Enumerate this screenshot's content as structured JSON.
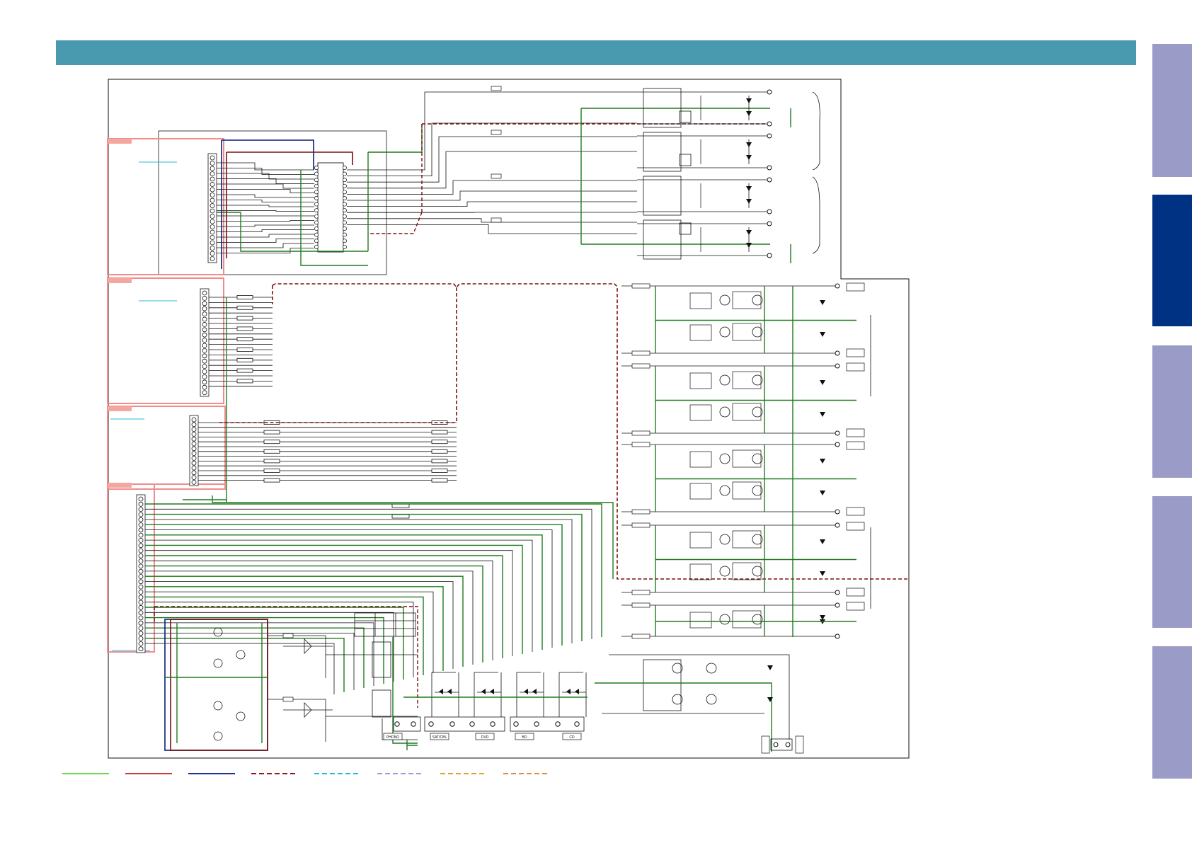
{
  "colors": {
    "header": "#4a9aaf",
    "tab_inactive": "#9b9bc8",
    "tab_active": "#003283",
    "green_wire": "#1f7a1f",
    "dark_red_wire": "#7a1010",
    "navy_wire": "#0a1f7a",
    "salmon_outline": "#f08c8c",
    "ink": "#111111"
  },
  "side_tabs": [
    {
      "id": "tab-1",
      "active": false
    },
    {
      "id": "tab-2",
      "active": true
    },
    {
      "id": "tab-3",
      "active": false
    },
    {
      "id": "tab-4",
      "active": false
    },
    {
      "id": "tab-5",
      "active": false
    }
  ],
  "connectors": {
    "phono": "PHONO",
    "cbl_sat": "SAT/CBL",
    "dvd": "DVD",
    "bd": "BD",
    "cd": "CD"
  },
  "legend": [
    {
      "name": "legend-green-solid",
      "color": "#6bd84a",
      "style": "solid"
    },
    {
      "name": "legend-red-solid",
      "color": "#c83c3c",
      "style": "solid"
    },
    {
      "name": "legend-navy-solid",
      "color": "#1e3296",
      "style": "solid"
    },
    {
      "name": "legend-darkred-dashed",
      "color": "#8c1a1a",
      "style": "dashed"
    },
    {
      "name": "legend-cyan-dashed",
      "color": "#2ab8e0",
      "style": "dashed"
    },
    {
      "name": "legend-lavender-dashed",
      "color": "#a89ad8",
      "style": "dashed"
    },
    {
      "name": "legend-amber-dashed",
      "color": "#e0a032",
      "style": "dashed"
    },
    {
      "name": "legend-orange-dashed",
      "color": "#e08c46",
      "style": "dashed"
    }
  ]
}
